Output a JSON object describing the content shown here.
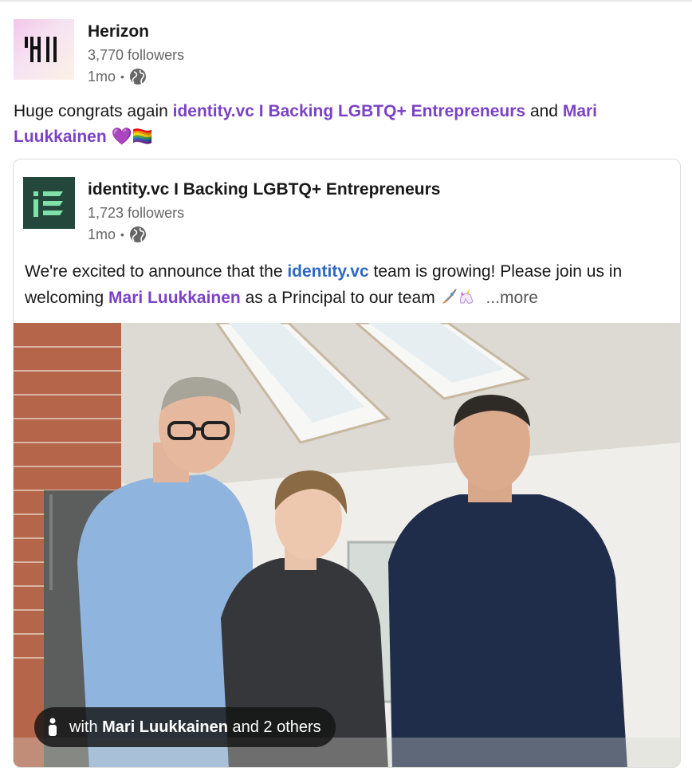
{
  "actor": {
    "name": "Herizon",
    "followers": "3,770 followers",
    "time": "1mo",
    "separator": "•",
    "logo_icon": "herizon-logo-icon",
    "visibility_icon": "globe-icon"
  },
  "commentary": {
    "prefix": "Huge congrats again ",
    "mention_1": "identity.vc I Backing LGBTQ+ Entrepreneurs",
    "middle": " and ",
    "mention_2": "Mari Luukkainen",
    "suffix": " 💜🏳️‍🌈"
  },
  "shared": {
    "name": "identity.vc I Backing LGBTQ+ Entrepreneurs",
    "followers": "1,723 followers",
    "time": "1mo",
    "separator": "•",
    "logo_icon": "identity-logo-icon",
    "visibility_icon": "globe-icon",
    "text_prefix": "We're excited to announce that the ",
    "text_link": "identity.vc",
    "text_mid": " team is growing! Please join us in welcoming ",
    "text_mention": "Mari Luukkainen",
    "text_suffix": " as a Principal to our team ",
    "emoji_icons": [
      "rocket-icon",
      "unicorn-icon"
    ],
    "more": "...more"
  },
  "photo": {
    "tag_prefix": "with ",
    "tag_name": "Mari Luukkainen",
    "tag_suffix": " and 2 others",
    "tag_icon": "person-icon"
  },
  "colors": {
    "mention": "#7b42c6",
    "link": "#2d68c4",
    "identity_logo_bg": "#24473b",
    "identity_logo_fg": "#7fe0a8"
  }
}
